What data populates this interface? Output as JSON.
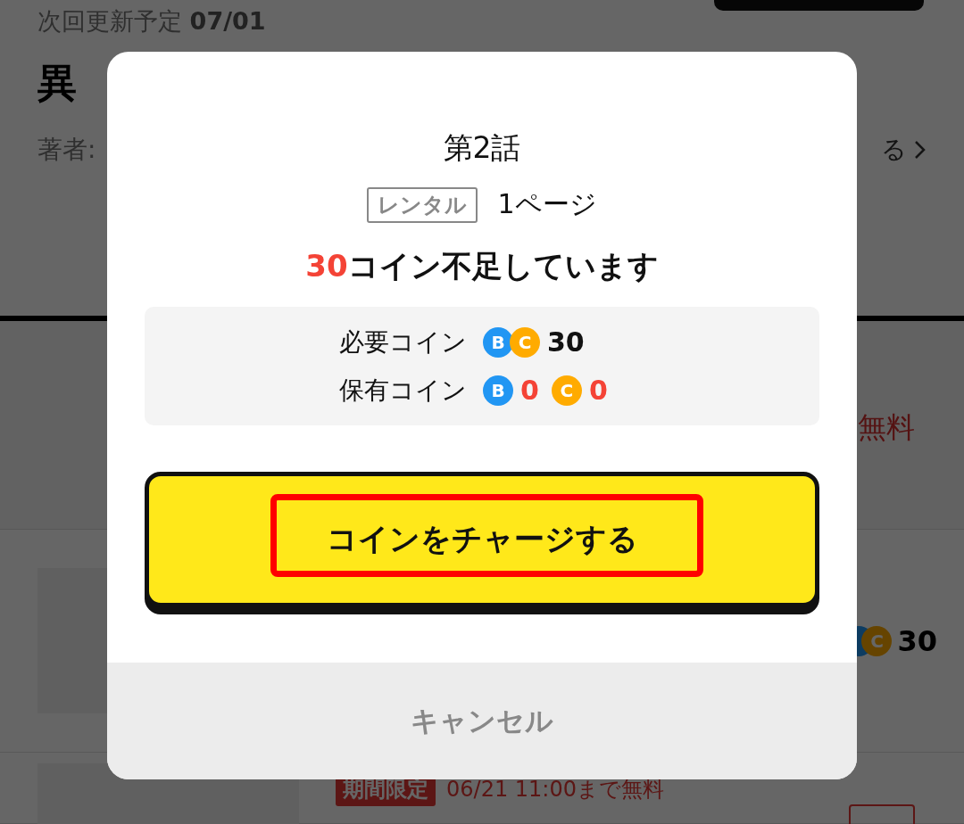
{
  "background": {
    "update_label": "次回更新予定",
    "update_date": "07/01",
    "title": "異",
    "author_label": "著者:",
    "more_link": "る",
    "rows": [
      {
        "kind": "price",
        "text": "無料"
      },
      {
        "kind": "coins",
        "coin": {
          "letter": "C"
        },
        "amount": "30"
      },
      {
        "kind": "campaign",
        "badge": "期間限定",
        "text": "06/21 11:00まで無料"
      }
    ]
  },
  "dialog": {
    "episode": "第2話",
    "tag": "レンタル",
    "pages": "1ページ",
    "shortage_amount": "30",
    "shortage_text": "コイン不足しています",
    "required": {
      "label": "必要コイン",
      "coins": [
        {
          "letter": "B",
          "color": "#2196f3"
        },
        {
          "letter": "C",
          "color": "#ffab00"
        }
      ],
      "amount": "30"
    },
    "owned": {
      "label": "保有コイン",
      "balances": [
        {
          "letter": "B",
          "color": "#2196f3",
          "amount": "0"
        },
        {
          "letter": "C",
          "color": "#ffab00",
          "amount": "0"
        }
      ]
    },
    "charge_button": "コインをチャージする",
    "cancel_button": "キャンセル"
  }
}
